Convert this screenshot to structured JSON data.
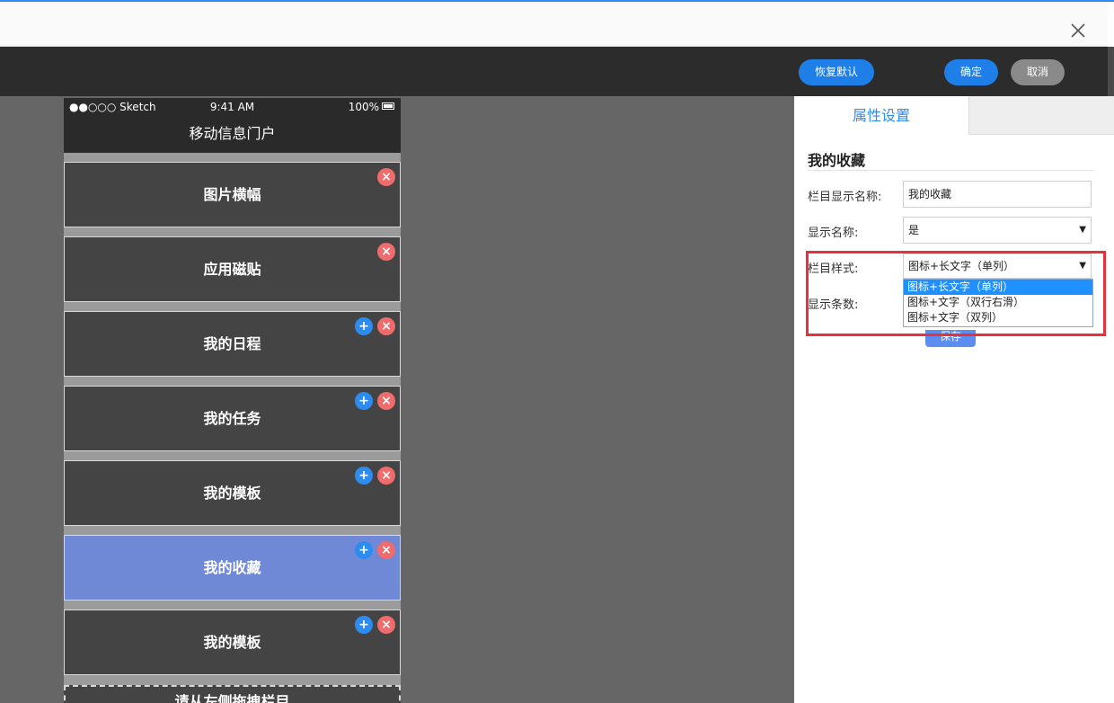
{
  "window": {
    "close_icon": "close-icon"
  },
  "toolbar": {
    "restore_label": "恢复默认",
    "ok_label": "确定",
    "cancel_label": "取消"
  },
  "phone": {
    "status": {
      "carrier": "●●○○○ Sketch",
      "time": "9:41 AM",
      "battery": "100%"
    },
    "title": "移动信息门户",
    "blocks": [
      {
        "label": "图片横幅"
      },
      {
        "label": "应用磁贴"
      },
      {
        "label": "我的日程"
      },
      {
        "label": "我的任务"
      },
      {
        "label": "我的模板"
      },
      {
        "label": "我的收藏"
      },
      {
        "label": "我的模板"
      }
    ],
    "dropzone_label": "请从左侧拖拽栏目"
  },
  "panel": {
    "tab_label": "属性设置",
    "section_title": "我的收藏",
    "fields": {
      "column_name_label": "栏目显示名称:",
      "column_name_value": "我的收藏",
      "show_name_label": "显示名称:",
      "show_name_value": "是",
      "style_label": "栏目样式:",
      "style_value": "图标+长文字（单列）",
      "count_label": "显示条数:"
    },
    "style_options": [
      "图标+长文字（单列）",
      "图标+文字（双行右滑）",
      "图标+文字（双列）"
    ],
    "save_label": "保存"
  },
  "colors": {
    "accent": "#1e7fe8",
    "highlight": "#e8313b",
    "active_block": "#7089d6",
    "delete": "#f06b6b"
  }
}
